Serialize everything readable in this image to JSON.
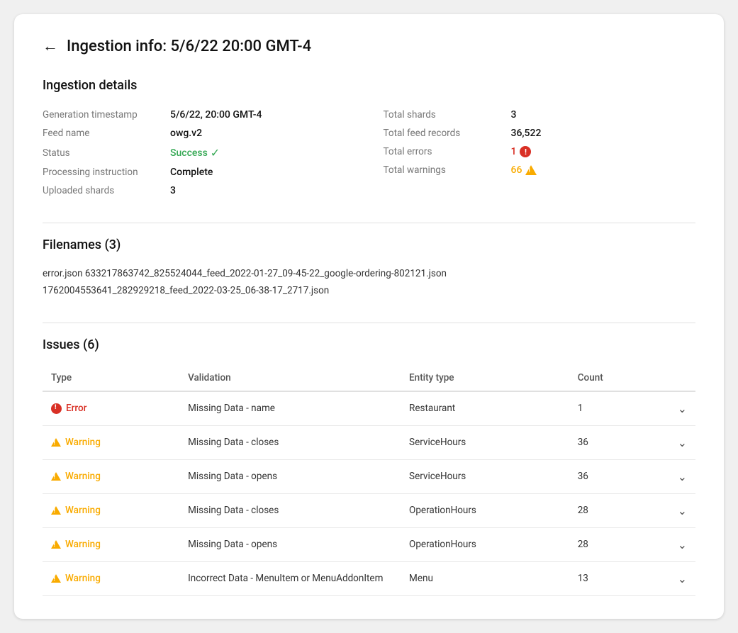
{
  "header": {
    "back_label": "←",
    "title": "Ingestion info: 5/6/22 20:00 GMT-4"
  },
  "ingestion_details": {
    "section_title": "Ingestion details",
    "left": [
      {
        "label": "Generation timestamp",
        "value": "5/6/22, 20:00 GMT-4",
        "bold": true
      },
      {
        "label": "Feed name",
        "value": "owg.v2",
        "bold": true
      },
      {
        "label": "Status",
        "value": "Success",
        "type": "success"
      },
      {
        "label": "Processing instruction",
        "value": "Complete",
        "bold": true
      },
      {
        "label": "Uploaded shards",
        "value": "3",
        "bold": true
      }
    ],
    "right": [
      {
        "label": "Total shards",
        "value": "3",
        "bold": true
      },
      {
        "label": "Total feed records",
        "value": "36,522",
        "bold": true
      },
      {
        "label": "Total errors",
        "value": "1",
        "type": "error"
      },
      {
        "label": "Total warnings",
        "value": "66",
        "type": "warning"
      }
    ]
  },
  "filenames": {
    "section_title": "Filenames (3)",
    "files": [
      "error.json                                   633217863742_825524044_feed_2022-01-27_09-45-22_google-ordering-802121.json",
      "1762004553641_282929218_feed_2022-03-25_06-38-17_2717.json"
    ]
  },
  "issues": {
    "section_title": "Issues (6)",
    "columns": [
      "Type",
      "Validation",
      "Entity type",
      "Count"
    ],
    "rows": [
      {
        "type": "Error",
        "type_style": "error",
        "validation": "Missing Data - name",
        "entity": "Restaurant",
        "count": "1"
      },
      {
        "type": "Warning",
        "type_style": "warning",
        "validation": "Missing Data - closes",
        "entity": "ServiceHours",
        "count": "36"
      },
      {
        "type": "Warning",
        "type_style": "warning",
        "validation": "Missing Data - opens",
        "entity": "ServiceHours",
        "count": "36"
      },
      {
        "type": "Warning",
        "type_style": "warning",
        "validation": "Missing Data - closes",
        "entity": "OperationHours",
        "count": "28"
      },
      {
        "type": "Warning",
        "type_style": "warning",
        "validation": "Missing Data - opens",
        "entity": "OperationHours",
        "count": "28"
      },
      {
        "type": "Warning",
        "type_style": "warning",
        "validation": "Incorrect Data - MenuItem or MenuAddonItem",
        "entity": "Menu",
        "count": "13"
      }
    ]
  }
}
